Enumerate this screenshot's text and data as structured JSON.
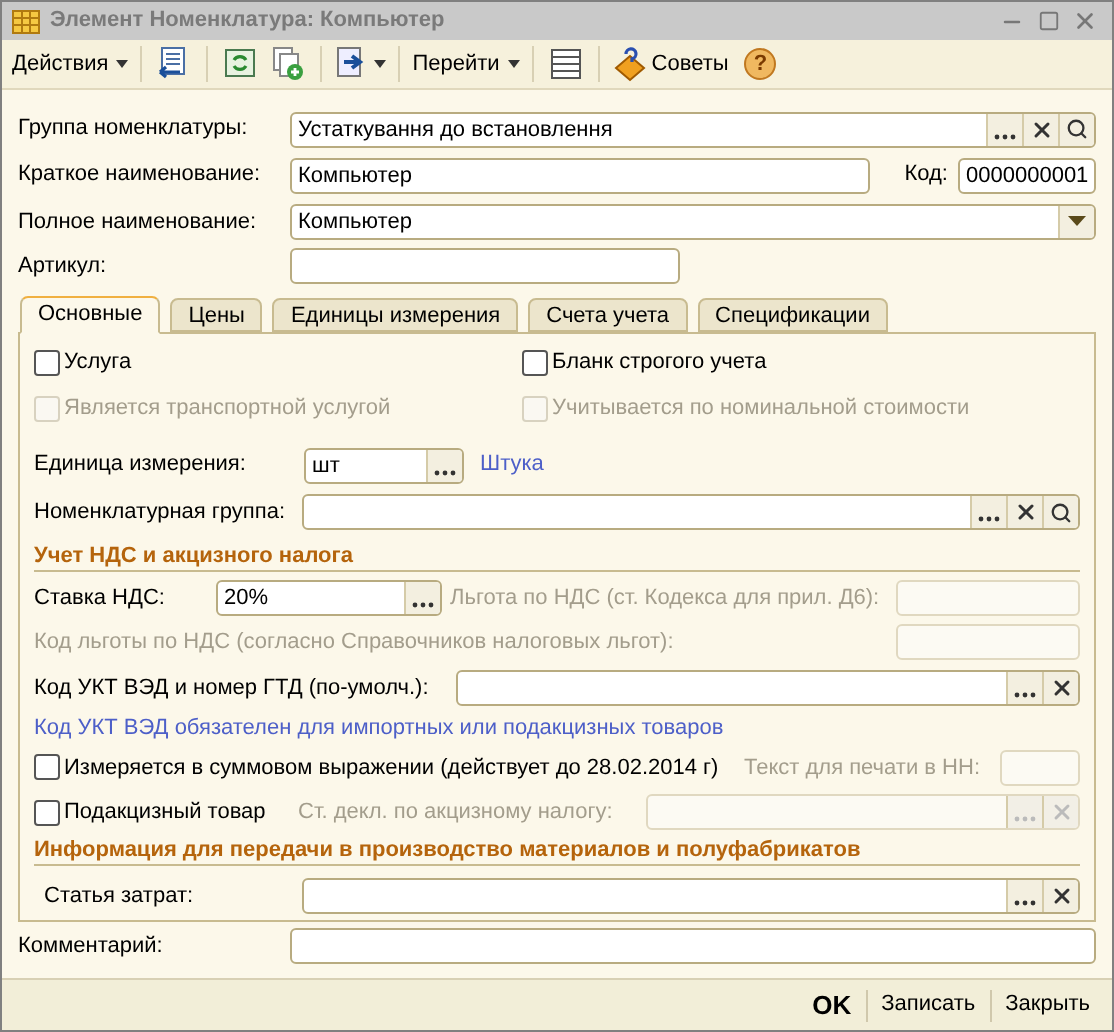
{
  "window": {
    "title": "Элемент Номенклатура: Компьютер"
  },
  "toolbar": {
    "actions": "Действия",
    "goto": "Перейти",
    "tips": "Советы",
    "help": "?"
  },
  "header": {
    "group": {
      "label": "Группа номенклатуры:",
      "value": "Устаткування до встановлення"
    },
    "short_name": {
      "label": "Краткое наименование:",
      "value": "Компьютер"
    },
    "code": {
      "label": "Код:",
      "value": "0000000001"
    },
    "full_name": {
      "label": "Полное наименование:",
      "value": "Компьютер"
    },
    "article": {
      "label": "Артикул:"
    }
  },
  "tabs": [
    {
      "label": "Основные",
      "selected": true
    },
    {
      "label": "Цены",
      "selected": false
    },
    {
      "label": "Единицы измерения",
      "selected": false
    },
    {
      "label": "Счета учета",
      "selected": false
    },
    {
      "label": "Спецификации",
      "selected": false
    }
  ],
  "main_tab": {
    "flags": [
      {
        "label": "Услуга",
        "checked": false,
        "disabled": false
      },
      {
        "label": "Бланк строгого учета",
        "checked": false,
        "disabled": false
      },
      {
        "label": "Является транспортной услугой",
        "checked": false,
        "disabled": true
      },
      {
        "label": "Учитывается по номинальной стоимости",
        "checked": false,
        "disabled": true
      }
    ],
    "unit": {
      "label": "Единица измерения:",
      "value": "шт",
      "link": "Штука"
    },
    "nom_group": {
      "label": "Номенклатурная группа:"
    },
    "vat_section": {
      "title": "Учет НДС и акцизного налога",
      "vat_rate": {
        "label": "Ставка НДС:",
        "value": "20%"
      },
      "vat_benefit": {
        "label": "Льгота по НДС (ст. Кодекса для прил. Д6):",
        "disabled": true
      },
      "benefit_code": {
        "label": "Код льготы по НДС (согласно Справочников налоговых льгот):",
        "disabled": true
      },
      "uktzed": {
        "label": "Код УКТ ВЭД и номер ГТД (по-умолч.):"
      },
      "uktzed_hint": "Код УКТ ВЭД обязателен для импортных или подакцизных товаров",
      "sum_measure": {
        "label": "Измеряется в суммовом выражении (действует до 28.02.2014 г)",
        "checked": false
      },
      "print_text": {
        "label": "Текст для печати в НН:",
        "disabled": true
      },
      "excise": {
        "label": "Подакцизный товар",
        "checked": false
      },
      "excise_decl": {
        "label": "Ст. декл. по акцизному налогу:",
        "disabled": true
      }
    },
    "production_section": {
      "title": "Информация для передачи в производство материалов и полуфабрикатов",
      "cost_item": {
        "label": "Статья затрат:"
      }
    }
  },
  "comment": {
    "label": "Комментарий:"
  },
  "footer": {
    "buttons": [
      "OK",
      "Записать",
      "Закрыть"
    ]
  }
}
